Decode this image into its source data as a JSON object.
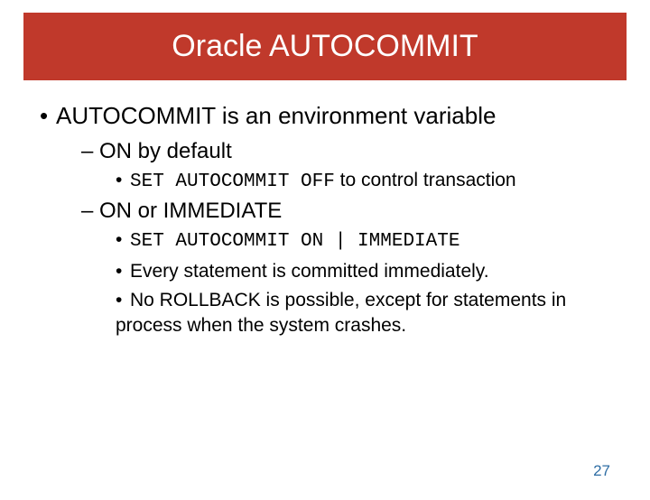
{
  "title": "Oracle AUTOCOMMIT",
  "bullets": {
    "l1": "AUTOCOMMIT is an environment variable",
    "l2a": "ON by default",
    "l3a_code": "SET AUTOCOMMIT OFF",
    "l3a_text": " to control transaction",
    "l2b": "ON or IMMEDIATE",
    "l3b_code": "SET AUTOCOMMIT ON | IMMEDIATE",
    "l3c": "Every statement is committed immediately.",
    "l3d": "No ROLLBACK is possible, except for statements in process when the system crashes."
  },
  "page_number": "27"
}
